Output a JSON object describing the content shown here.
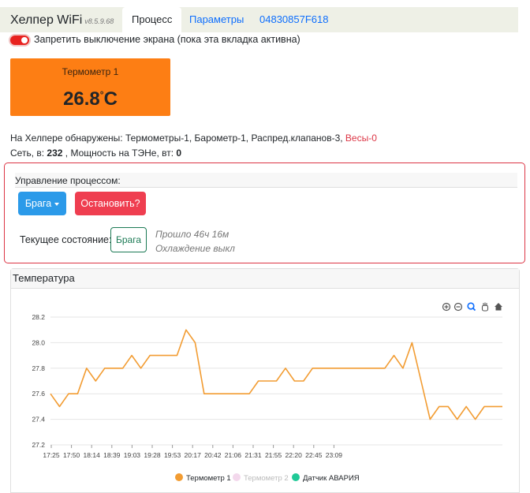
{
  "header": {
    "brand": "Хелпер WiFi",
    "version": "v8.5.9.68",
    "tabs": [
      {
        "label": "Процесс",
        "active": true
      },
      {
        "label": "Параметры",
        "active": false
      },
      {
        "label": "04830857F618",
        "active": false
      }
    ]
  },
  "screen_toggle": {
    "label": "Запретить выключение экрана (пока эта вкладка активна)",
    "on": true
  },
  "thermometer": {
    "name": "Термометр 1",
    "value": "26.8",
    "unit": "C",
    "degree": "°"
  },
  "detected": {
    "prefix": "На Хелпере обнаружены: Термометры-1, Барометр-1, Распред.клапанов-3, ",
    "warning": "Весы-0"
  },
  "power": {
    "net_label": "Сеть, в:",
    "net_value": "232",
    "power_label": ", Мощность на ТЭНе, вт:",
    "power_value": "0"
  },
  "process": {
    "title": "Управление процессом:",
    "mode_button": "Брага",
    "stop_button": "Остановить?",
    "state_label": "Текущее состояние:",
    "state_value": "Брага",
    "elapsed": "Прошло 46ч 16м",
    "cooling": "Охлаждение выкл"
  },
  "temperature_panel": {
    "title": "Температура"
  },
  "colors": {
    "thermo1": "#f29c32",
    "thermo2": "#f3d8ec",
    "alarm": "#20c997",
    "orange_card": "#fd7e14"
  },
  "toolbar_icons": [
    "zoom-in-icon",
    "zoom-out-icon",
    "zoom-select-icon",
    "pan-hand-icon",
    "home-icon"
  ],
  "chart_data": {
    "type": "line",
    "title": "",
    "xlabel": "",
    "ylabel": "",
    "ylim": [
      27.2,
      28.2
    ],
    "yticks": [
      "28.2",
      "28.0",
      "27.8",
      "27.6",
      "27.4",
      "27.2"
    ],
    "xticks": [
      "17:25",
      "17:50",
      "18:14",
      "18:39",
      "19:03",
      "19:28",
      "19:53",
      "20:17",
      "20:42",
      "21:06",
      "21:31",
      "21:55",
      "22:20",
      "22:45",
      "23:09"
    ],
    "grid": true,
    "legend_position": "bottom",
    "series": [
      {
        "name": "Термометр 1",
        "x": [
          0,
          2,
          4,
          6,
          8,
          10,
          12,
          14,
          16,
          18,
          20,
          22,
          24,
          26,
          28,
          30,
          32,
          34,
          36,
          38,
          40,
          42,
          44,
          46,
          48,
          50,
          52,
          54,
          56,
          58,
          60,
          62,
          64,
          66,
          68,
          70,
          72,
          74,
          76,
          78,
          80,
          82,
          84,
          86,
          88,
          90,
          92,
          94,
          96,
          98,
          100
        ],
        "values": [
          27.6,
          27.5,
          27.6,
          27.6,
          27.8,
          27.7,
          27.8,
          27.8,
          27.8,
          27.9,
          27.8,
          27.9,
          27.9,
          27.9,
          27.9,
          28.1,
          28.0,
          27.6,
          27.6,
          27.6,
          27.6,
          27.6,
          27.6,
          27.7,
          27.7,
          27.7,
          27.8,
          27.7,
          27.7,
          27.8,
          27.8,
          27.8,
          27.8,
          27.8,
          27.8,
          27.8,
          27.8,
          27.8,
          27.9,
          27.8,
          28.0,
          27.7,
          27.4,
          27.5,
          27.5,
          27.4,
          27.5,
          27.4,
          27.5,
          27.5,
          27.5
        ]
      },
      {
        "name": "Термометр 2",
        "values": []
      },
      {
        "name": "Датчик АВАРИЯ",
        "values": []
      }
    ]
  }
}
